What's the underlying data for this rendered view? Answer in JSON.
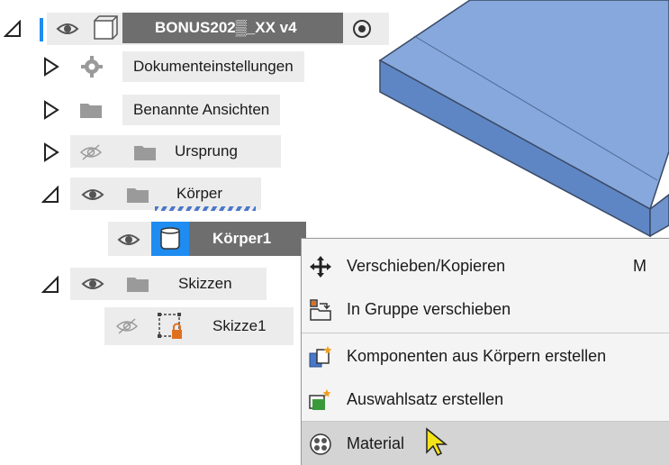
{
  "tree": {
    "root": {
      "label": "BONUS202▒_XX v4"
    },
    "items": [
      {
        "label": "Dokumenteinstellungen"
      },
      {
        "label": "Benannte Ansichten"
      },
      {
        "label": "Ursprung"
      },
      {
        "label": "Körper"
      },
      {
        "label": "Körper1"
      },
      {
        "label": "Skizzen"
      },
      {
        "label": "Skizze1"
      }
    ]
  },
  "context_menu": {
    "items": [
      {
        "label": "Verschieben/Kopieren",
        "shortcut": "M",
        "icon": "move-icon"
      },
      {
        "label": "In Gruppe verschieben",
        "icon": "move-to-group-icon"
      },
      {
        "label": "Komponenten aus Körpern erstellen",
        "icon": "create-components-icon"
      },
      {
        "label": "Auswahlsatz erstellen",
        "icon": "selection-set-icon"
      },
      {
        "label": "Material",
        "icon": "material-icon"
      }
    ]
  },
  "colors": {
    "body_blue": "#7fa2d8",
    "body_blue_dark": "#5f86c4",
    "selection_blue": "#1e8cf0",
    "root_grey": "#6e6e6e"
  }
}
